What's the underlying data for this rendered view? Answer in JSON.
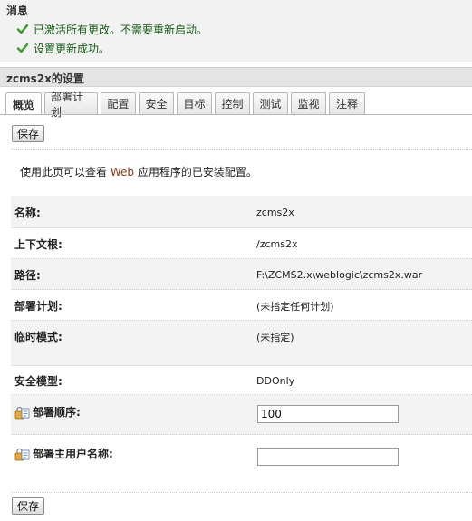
{
  "messages": {
    "title": "消息",
    "items": [
      "已激活所有更改。不需要重新启动。",
      "设置更新成功。"
    ]
  },
  "settings": {
    "title": "zcms2x的设置"
  },
  "tabs": [
    "概览",
    "部署计划",
    "配置",
    "安全",
    "目标",
    "控制",
    "测试",
    "监视",
    "注释"
  ],
  "active_tab": "概览",
  "buttons": {
    "save_top": "保存",
    "save_bottom": "保存"
  },
  "intro": {
    "before": "使用此页可以查看 ",
    "highlight": "Web",
    "after": " 应用程序的已安装配置。"
  },
  "properties": {
    "name_label": "名称:",
    "name_value": "zcms2x",
    "context_label": "上下文根:",
    "context_value": "/zcms2x",
    "path_label": "路径:",
    "path_value": "F:\\ZCMS2.x\\weblogic\\zcms2x.war",
    "plan_label": "部署计划:",
    "plan_value": "(未指定任何计划)",
    "staging_label": "临时模式:",
    "staging_value": "(未指定)",
    "security_label": "安全模型:",
    "security_value": "DDOnly",
    "order_label": "部署顺序:",
    "order_value": "100",
    "principal_label": "部署主用户名称:",
    "principal_value": ""
  },
  "colors": {
    "message_text": "#1a5d1a",
    "check_green": "#3a9a2a",
    "highlight_link": "#8a3a1a"
  },
  "icons": {
    "message_check": "check-icon",
    "editable_field": "lock-edit-icon"
  }
}
